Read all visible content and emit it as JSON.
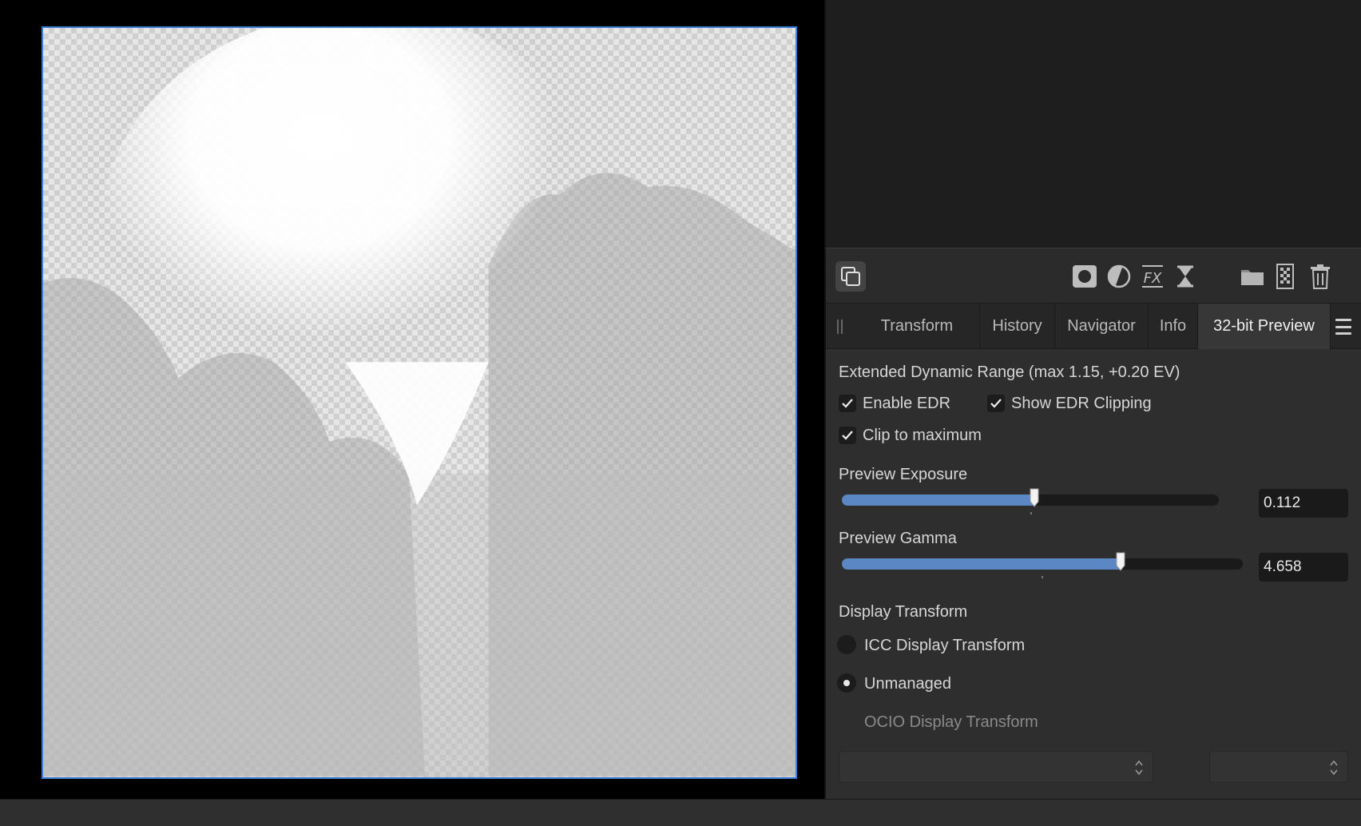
{
  "tabs": [
    {
      "label": "Transform"
    },
    {
      "label": "History"
    },
    {
      "label": "Navigator"
    },
    {
      "label": "Info"
    },
    {
      "label": "32-bit Preview",
      "active": true
    }
  ],
  "preview": {
    "edr_heading": "Extended Dynamic Range (max 1.15, +0.20 EV)",
    "enable_edr": {
      "label": "Enable EDR",
      "checked": true
    },
    "show_edr_clipping": {
      "label": "Show EDR Clipping",
      "checked": true
    },
    "clip_to_maximum": {
      "label": "Clip to maximum",
      "checked": true
    },
    "exposure": {
      "label": "Preview Exposure",
      "value": "0.112",
      "slider_fraction": 0.51
    },
    "gamma": {
      "label": "Preview Gamma",
      "value": "4.658",
      "slider_fraction": 0.695
    },
    "display_transform": {
      "heading": "Display Transform",
      "options": [
        {
          "label": "ICC Display Transform",
          "selected": false
        },
        {
          "label": "Unmanaged",
          "selected": true
        },
        {
          "label": "OCIO Display Transform",
          "disabled": true
        }
      ]
    },
    "ocio_selects": [
      {
        "value": ""
      },
      {
        "value": ""
      }
    ]
  },
  "icons": {
    "toolbar": [
      "layers-mode-icon",
      "mask-icon",
      "adjustment-icon",
      "fx-icon",
      "live-filter-icon",
      "folder-icon",
      "checker-icon",
      "trash-icon"
    ]
  },
  "colors": {
    "accent": "#5b87c4",
    "selection": "#3c7fd9",
    "panel": "#2e2e2e"
  }
}
